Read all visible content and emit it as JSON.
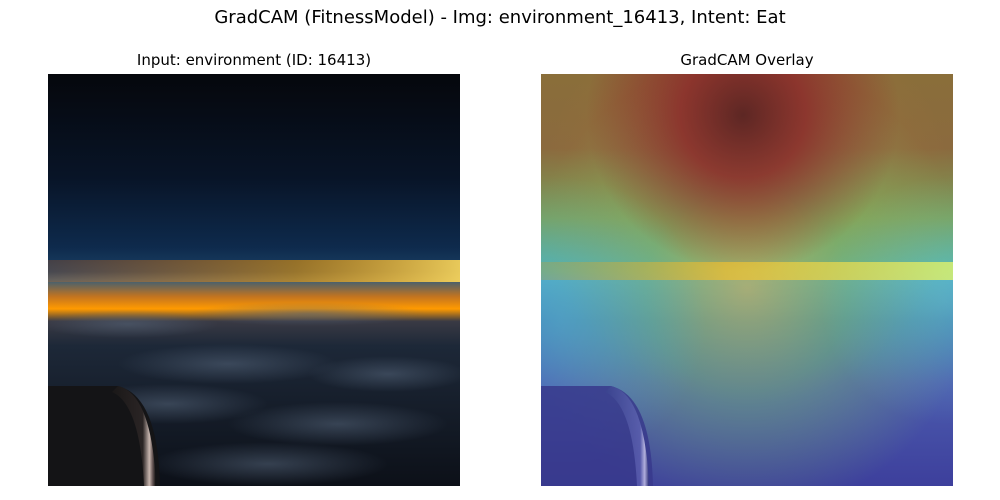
{
  "figure": {
    "title": "GradCAM (FitnessModel) - Img: environment_16413, Intent: Eat"
  },
  "panels": [
    {
      "title": "Input: environment (ID: 16413)",
      "scene": "twilight sky over clouds viewed from aircraft window with engine nacelle in lower left"
    },
    {
      "title": "GradCAM Overlay",
      "colormap": "jet"
    }
  ],
  "colors": {
    "sky_top": "#05070c",
    "sky_mid": "#0e2a4c",
    "horizon_orange": "#ff9a00",
    "horizon_yellow": "#ffd95a",
    "cloud_dark": "#1c2635",
    "heat_hot": "#8b2a2a",
    "heat_warm": "#8a7a3d",
    "heat_green": "#6fbf6f",
    "heat_cyan": "#4aa6c9",
    "heat_cool": "#3d3f9c"
  }
}
